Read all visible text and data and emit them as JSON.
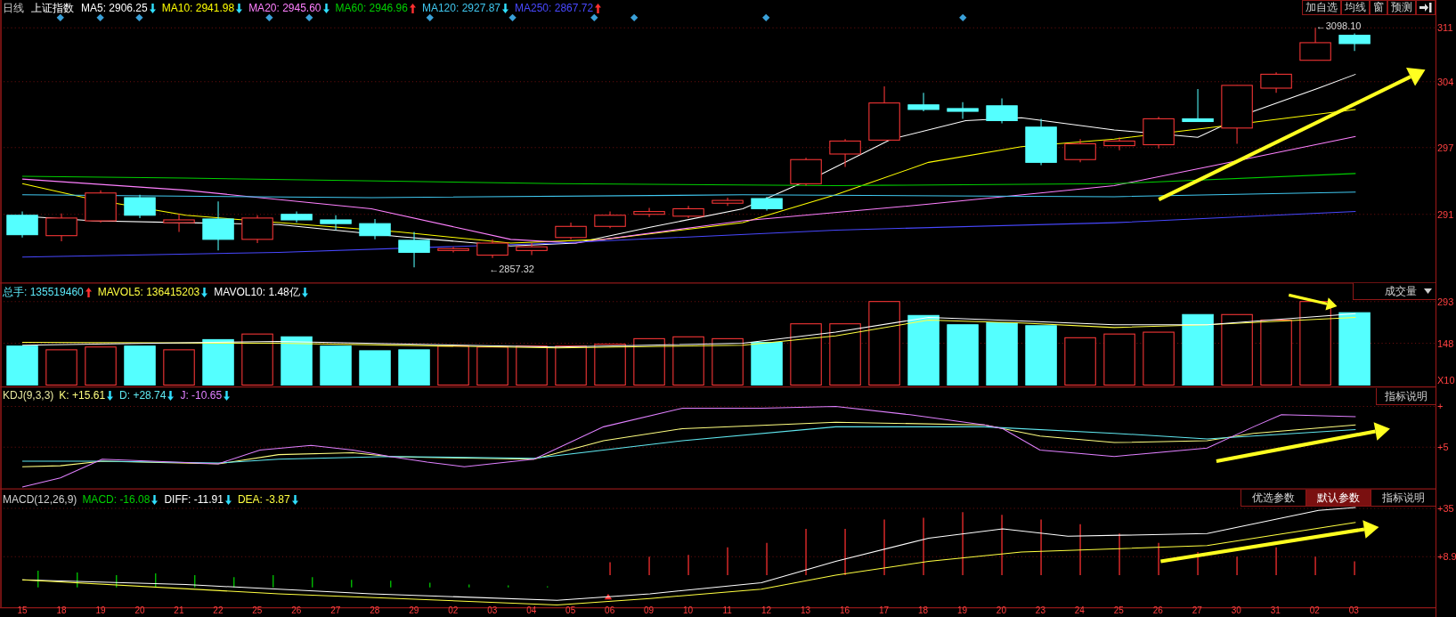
{
  "header": {
    "period": "日线",
    "index_name": "上证指数",
    "indicators": [
      {
        "text": "MA5: 2906.25",
        "rising": false,
        "color": "#ffffff"
      },
      {
        "text": "MA10: 2941.98",
        "rising": false,
        "color": "#ffff00"
      },
      {
        "text": "MA20: 2945.60",
        "rising": false,
        "color": "#ff80ff"
      },
      {
        "text": "MA60: 2946.96",
        "rising": true,
        "color": "#00d000"
      },
      {
        "text": "MA120: 2927.87",
        "rising": false,
        "color": "#40c8f0"
      },
      {
        "text": "MA250: 2867.72",
        "rising": true,
        "color": "#4848ff"
      }
    ]
  },
  "toolbar": {
    "buttons": [
      "加自选",
      "均线",
      "窗",
      "预测"
    ]
  },
  "price_axis": [
    "311",
    "304",
    "297",
    "291"
  ],
  "price_annotations": [
    "←2857.32",
    "←3098.10"
  ],
  "volume": {
    "indicators": [
      {
        "text": "总手: 135519460",
        "rising": true,
        "color": "#5ce8f8"
      },
      {
        "text": "MAVOL5: 136415203",
        "rising": false,
        "color": "#ffff40"
      },
      {
        "text": "MAVOL10: 1.48亿",
        "rising": false,
        "color": "#ffffff"
      }
    ],
    "dropdown": "成交量",
    "axis": [
      "293",
      "148",
      "X10"
    ]
  },
  "kdj": {
    "title": "KDJ(9,3,3)",
    "indicators": [
      {
        "text": "K: +15.61",
        "rising": false,
        "color": "#ffff80"
      },
      {
        "text": "D: +28.74",
        "rising": false,
        "color": "#60e8f0"
      },
      {
        "text": "J: -10.65",
        "rising": false,
        "color": "#e080ff"
      }
    ],
    "button": "指标说明",
    "axis": [
      "+",
      "+5"
    ]
  },
  "macd": {
    "title": "MACD(12,26,9)",
    "indicators": [
      {
        "text": "MACD: -16.08",
        "rising": false,
        "color": "#00d000"
      },
      {
        "text": "DIFF: -11.91",
        "rising": false,
        "color": "#ffffff"
      },
      {
        "text": "DEA: -3.87",
        "rising": false,
        "color": "#ffff40"
      }
    ],
    "buttons": [
      {
        "label": "优选参数",
        "selected": false
      },
      {
        "label": "默认参数",
        "selected": true
      },
      {
        "label": "指标说明",
        "selected": false
      }
    ],
    "axis": [
      "+35",
      "+8.9"
    ]
  },
  "x_axis": [
    "15",
    "18",
    "19",
    "20",
    "21",
    "22",
    "25",
    "26",
    "27",
    "28",
    "29",
    "02",
    "03",
    "04",
    "05",
    "06",
    "09",
    "10",
    "11",
    "12",
    "13",
    "16",
    "17",
    "18",
    "19",
    "20",
    "23",
    "24",
    "25",
    "26",
    "27",
    "30",
    "31",
    "02",
    "03"
  ]
}
